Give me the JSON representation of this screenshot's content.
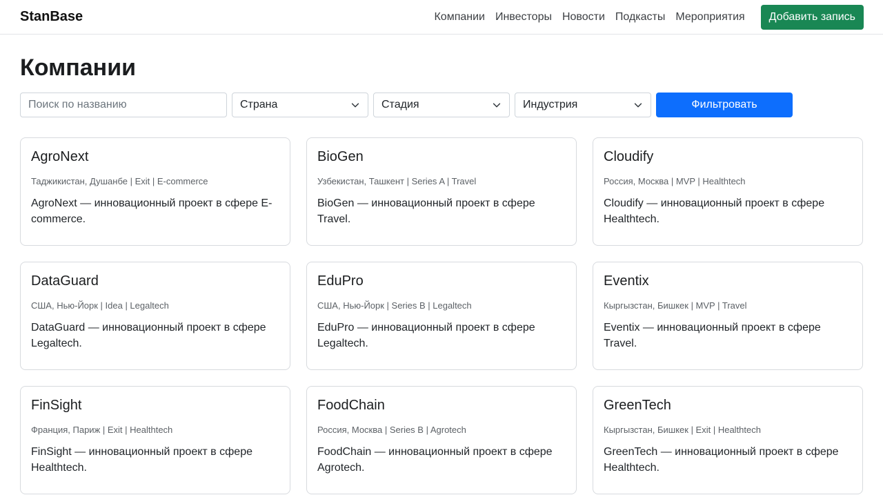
{
  "navbar": {
    "brand": "StanBase",
    "links": [
      "Компании",
      "Инвесторы",
      "Новости",
      "Подкасты",
      "Мероприятия"
    ],
    "add_button": "Добавить запись"
  },
  "page": {
    "title": "Компании"
  },
  "filters": {
    "search_placeholder": "Поиск по названию",
    "country": "Страна",
    "stage": "Стадия",
    "industry": "Индустрия",
    "submit": "Фильтровать"
  },
  "companies": [
    {
      "name": "AgroNext",
      "meta": "Таджикистан, Душанбе | Exit | E-commerce",
      "description": "AgroNext — инновационный проект в сфере E-commerce."
    },
    {
      "name": "BioGen",
      "meta": "Узбекистан, Ташкент | Series A | Travel",
      "description": "BioGen — инновационный проект в сфере Travel."
    },
    {
      "name": "Cloudify",
      "meta": "Россия, Москва | MVP | Healthtech",
      "description": "Cloudify — инновационный проект в сфере Healthtech."
    },
    {
      "name": "DataGuard",
      "meta": "США, Нью-Йорк | Idea | Legaltech",
      "description": "DataGuard — инновационный проект в сфере Legaltech."
    },
    {
      "name": "EduPro",
      "meta": "США, Нью-Йорк | Series B | Legaltech",
      "description": "EduPro — инновационный проект в сфере Legaltech."
    },
    {
      "name": "Eventix",
      "meta": "Кыргызстан, Бишкек | MVP | Travel",
      "description": "Eventix — инновационный проект в сфере Travel."
    },
    {
      "name": "FinSight",
      "meta": "Франция, Париж | Exit | Healthtech",
      "description": "FinSight — инновационный проект в сфере Healthtech."
    },
    {
      "name": "FoodChain",
      "meta": "Россия, Москва | Series B | Agrotech",
      "description": "FoodChain — инновационный проект в сфере Agrotech."
    },
    {
      "name": "GreenTech",
      "meta": "Кыргызстан, Бишкек | Exit | Healthtech",
      "description": "GreenTech — инновационный проект в сфере Healthtech."
    }
  ]
}
